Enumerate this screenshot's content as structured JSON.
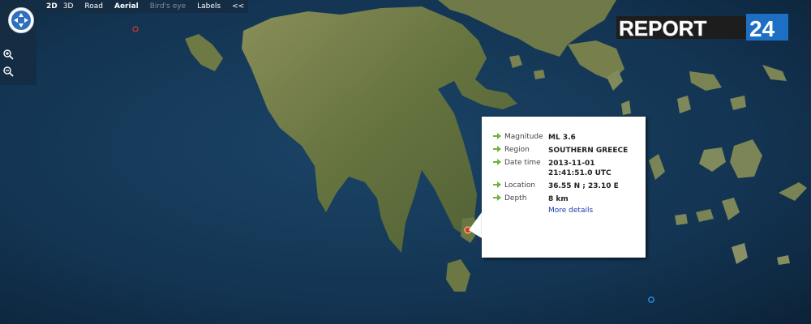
{
  "toolbar": {
    "mode_2d": "2D",
    "mode_3d": "3D",
    "road": "Road",
    "aerial": "Aerial",
    "birds_eye": "Bird's eye",
    "labels": "Labels",
    "collapse": "<<"
  },
  "brand": {
    "text_main": "REPORT",
    "text_num": "24"
  },
  "popup": {
    "magnitude_label": "Magnitude",
    "magnitude_value": "ML 3.6",
    "region_label": "Region",
    "region_value": "SOUTHERN GREECE",
    "datetime_label": "Date time",
    "date_value": "2013-11-01",
    "time_value": "21:41:51.0 UTC",
    "location_label": "Location",
    "location_value": "36.55 N ; 23.10 E",
    "depth_label": "Depth",
    "depth_value": "8 km",
    "more_details": "More details"
  },
  "colors": {
    "sea": "#12314a",
    "land": "#6e7d4c",
    "arrow": "#6db33f",
    "link": "#1a3caa",
    "marker": "#d83a2a"
  },
  "icons": [
    "compass-icon",
    "zoom-in-icon",
    "zoom-out-icon",
    "arrow-icon",
    "earthquake-marker-icon"
  ]
}
